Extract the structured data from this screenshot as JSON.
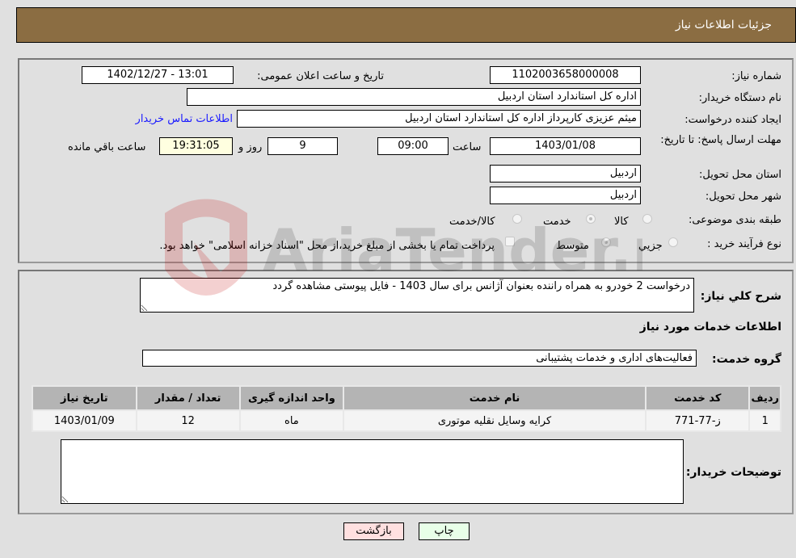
{
  "header": {
    "title": "جزئیات اطلاعات نیاز"
  },
  "form": {
    "need_number": {
      "label": "شماره نیاز:",
      "value": "1102003658000008"
    },
    "announce_datetime": {
      "label": "تاریخ و ساعت اعلان عمومی:",
      "value": "1402/12/27 - 13:01"
    },
    "buyer_org": {
      "label": "نام دستگاه خریدار:",
      "value": "اداره کل استاندارد استان اردبیل"
    },
    "requester": {
      "label": "ایجاد کننده درخواست:",
      "value": "میثم عزیزی کارپرداز اداره کل استاندارد استان اردبیل"
    },
    "buyer_contact_link": "اطلاعات تماس خریدار",
    "deadline": {
      "label": "مهلت ارسال پاسخ: تا تاریخ:",
      "date": "1403/01/08",
      "time_label": "ساعت",
      "time": "09:00",
      "days": "9",
      "days_label": "روز و",
      "remaining": "19:31:05",
      "remaining_label": "ساعت باقي مانده"
    },
    "delivery_province": {
      "label": "استان محل تحویل:",
      "value": "اردبیل"
    },
    "delivery_city": {
      "label": "شهر محل تحویل:",
      "value": "اردبیل"
    },
    "category": {
      "label": "طبقه بندی موضوعی:",
      "options": [
        "کالا",
        "خدمت",
        "کالا/خدمت"
      ],
      "selected": "خدمت"
    },
    "purchase_process": {
      "label": "نوع فرآیند خرید :",
      "options": [
        "جزیي",
        "متوسط"
      ],
      "selected": "متوسط",
      "treasury_note": "پرداخت تمام یا بخشی از مبلغ خرید،از محل \"اسناد خزانه اسلامی\" خواهد بود."
    }
  },
  "details": {
    "description_label": "شرح کلي نياز:",
    "description": "درخواست 2 خودرو به همراه راننده بعنوان آژانس برای سال 1403 - فایل پیوستی مشاهده گردد",
    "services_heading": "اطلاعات خدمات مورد نیاز",
    "service_group_label": "گروه خدمت:",
    "service_group": "فعالیت‌های اداری و خدمات پشتیبانی",
    "table": {
      "headers": [
        "ردیف",
        "کد خدمت",
        "نام خدمت",
        "واحد اندازه گیری",
        "تعداد / مقدار",
        "تاریخ نیاز"
      ],
      "rows": [
        [
          "1",
          "ز-77-771",
          "کرایه وسایل نقلیه موتوری",
          "ماه",
          "12",
          "1403/01/09"
        ]
      ]
    },
    "buyer_notes_label": "توضیحات خریدار:",
    "buyer_notes": ""
  },
  "buttons": {
    "print": "چاپ",
    "back": "بازگشت"
  },
  "watermark": "AriaTender.neT"
}
